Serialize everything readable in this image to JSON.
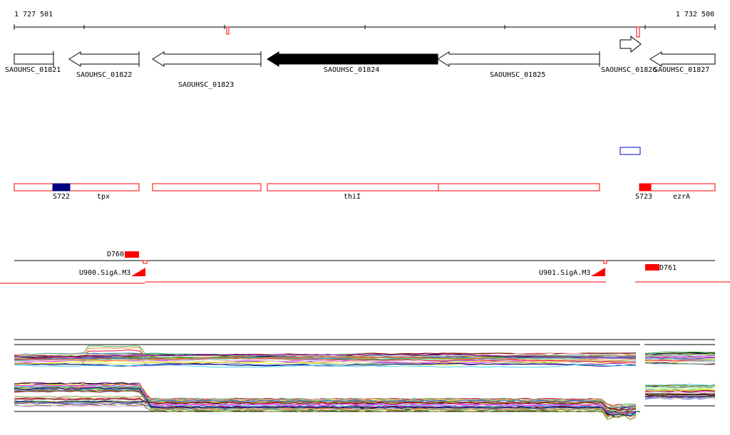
{
  "ruler": {
    "start_label": "1 727 501",
    "end_label": "1 732 500"
  },
  "genes": [
    {
      "name": "SAOUHSC_01821",
      "strand": "+",
      "highlighted": false
    },
    {
      "name": "SAOUHSC_01822",
      "strand": "-",
      "highlighted": false
    },
    {
      "name": "SAOUHSC_01823",
      "strand": "-",
      "highlighted": false
    },
    {
      "name": "SAOUHSC_01824",
      "strand": "-",
      "highlighted": true
    },
    {
      "name": "SAOUHSC_01825",
      "strand": "-",
      "highlighted": false
    },
    {
      "name": "SAOUHSC_01826",
      "strand": "+",
      "highlighted": false
    },
    {
      "name": "SAOUHSC_01827",
      "strand": "-",
      "highlighted": false
    }
  ],
  "gene_names": {
    "tpx": "tpx",
    "thiI": "thiI",
    "ezrA": "ezrA"
  },
  "features": {
    "S722": "S722",
    "S723": "S723",
    "D760": "D760",
    "D761": "D761",
    "U900": "U900.SigA.M3",
    "U901": "U901.SigA.M3"
  },
  "colors": {
    "gene_fill": "#ffffff",
    "gene_highlight": "#000000",
    "feature_red": "#ff0000",
    "feature_blue": "#000080",
    "outline_blue": "#0000cc"
  }
}
